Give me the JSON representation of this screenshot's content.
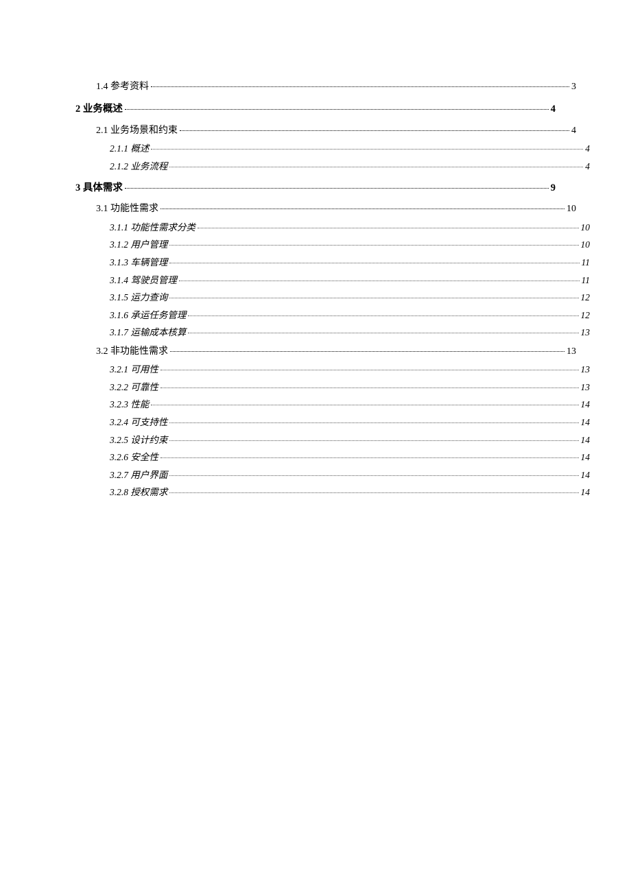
{
  "toc": {
    "entries": [
      {
        "level": 2,
        "label": "1.4 参考资料",
        "page": "3"
      },
      {
        "level": 1,
        "label": "2 业务概述",
        "page": "4"
      },
      {
        "level": 2,
        "label": "2.1 业务场景和约束",
        "page": "4"
      },
      {
        "level": 3,
        "label": "2.1.1 概述",
        "page": "4"
      },
      {
        "level": 3,
        "label": "2.1.2 业务流程",
        "page": "4"
      },
      {
        "level": 1,
        "label": "3 具体需求",
        "page": "9"
      },
      {
        "level": 2,
        "label": "3.1 功能性需求",
        "page": "10"
      },
      {
        "level": 3,
        "label": "3.1.1 功能性需求分类",
        "page": "10"
      },
      {
        "level": 3,
        "label": "3.1.2 用户管理",
        "page": "10"
      },
      {
        "level": 3,
        "label": "3.1.3 车辆管理",
        "page": "11"
      },
      {
        "level": 3,
        "label": "3.1.4 驾驶员管理",
        "page": "11"
      },
      {
        "level": 3,
        "label": "3.1.5 运力查询",
        "page": "12"
      },
      {
        "level": 3,
        "label": "3.1.6 承运任务管理",
        "page": "12"
      },
      {
        "level": 3,
        "label": "3.1.7 运输成本核算",
        "page": "13"
      },
      {
        "level": 2,
        "label": "3.2 非功能性需求",
        "page": "13"
      },
      {
        "level": 3,
        "label": "3.2.1 可用性",
        "page": "13"
      },
      {
        "level": 3,
        "label": "3.2.2 可靠性",
        "page": "13"
      },
      {
        "level": 3,
        "label": "3.2.3 性能",
        "page": "14"
      },
      {
        "level": 3,
        "label": "3.2.4 可支持性",
        "page": "14"
      },
      {
        "level": 3,
        "label": "3.2.5 设计约束",
        "page": "14"
      },
      {
        "level": 3,
        "label": "3.2.6 安全性",
        "page": "14"
      },
      {
        "level": 3,
        "label": "3.2.7 用户界面",
        "page": "14"
      },
      {
        "level": 3,
        "label": "3.2.8 授权需求",
        "page": "14"
      }
    ]
  }
}
